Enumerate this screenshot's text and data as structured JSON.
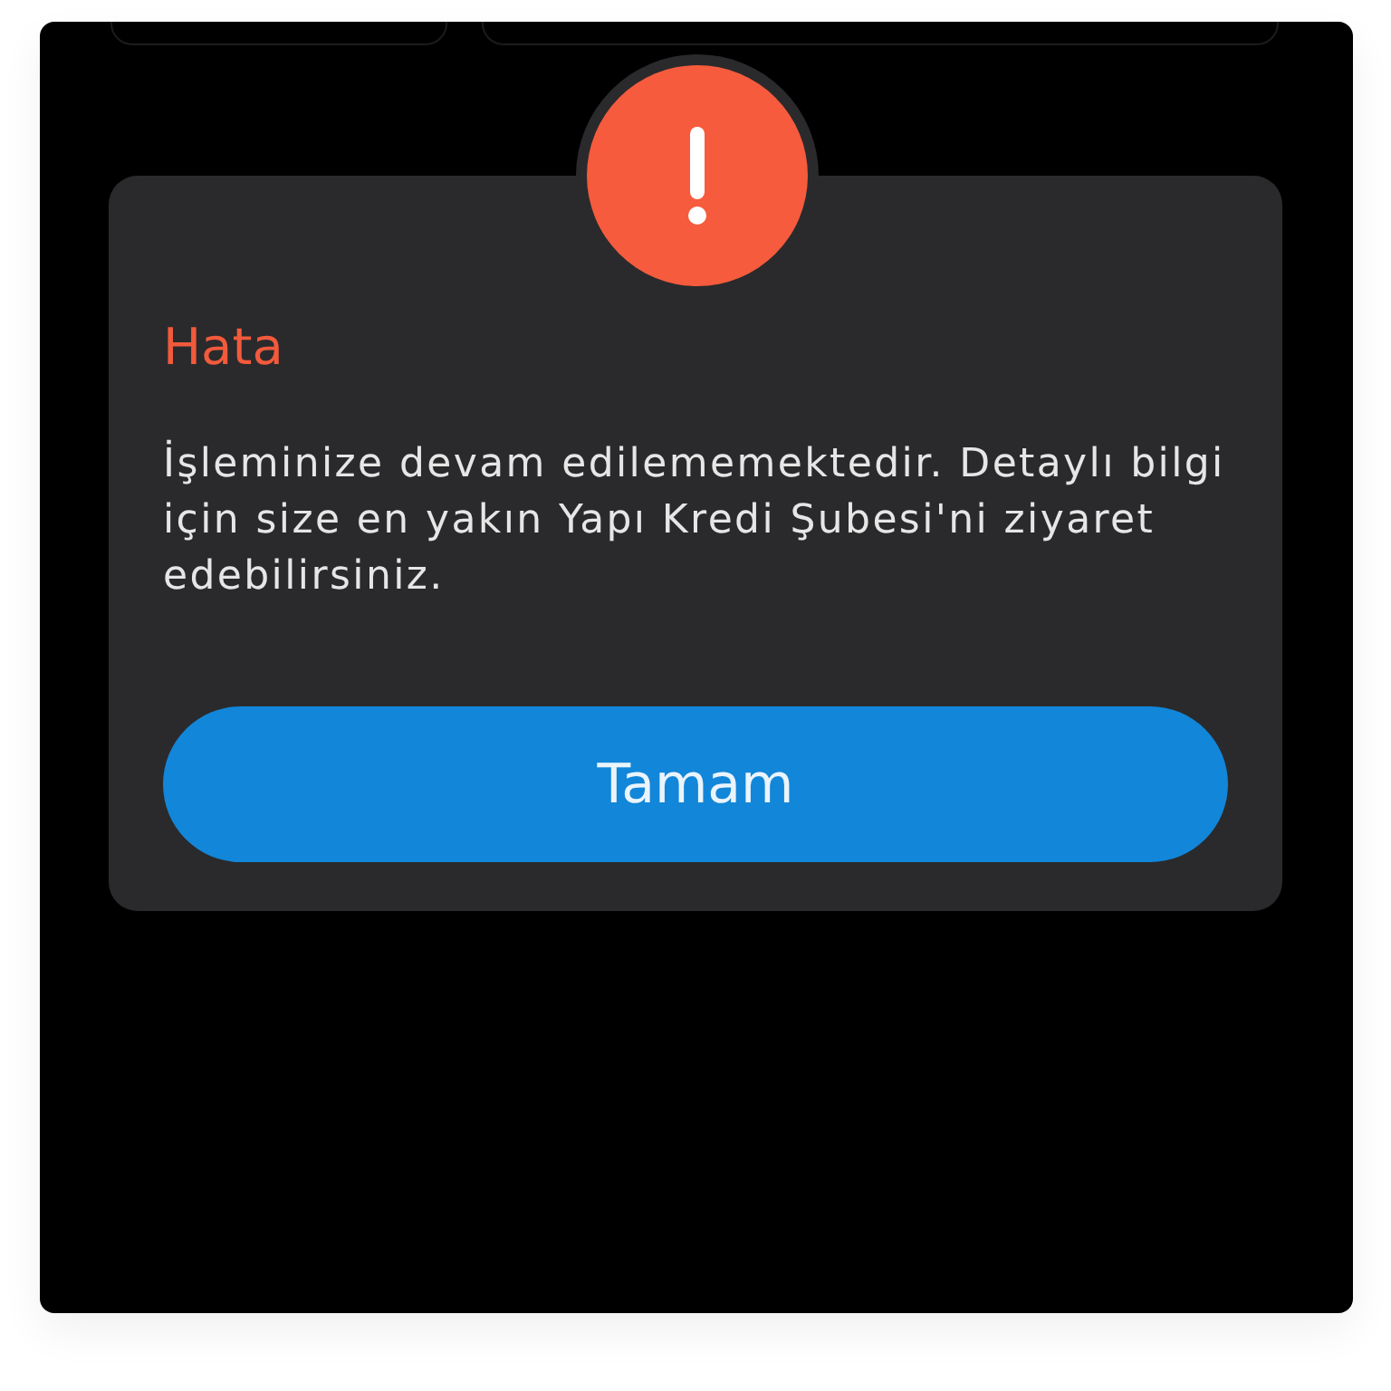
{
  "dialog": {
    "title": "Hata",
    "message": "İşleminize devam edilememektedir. Detaylı bilgi için size en yakın Yapı Kredi Şubesi'ni ziyaret edebilirsiniz.",
    "buttons": [
      {
        "label": "Tamam",
        "kind": "primary"
      }
    ]
  }
}
